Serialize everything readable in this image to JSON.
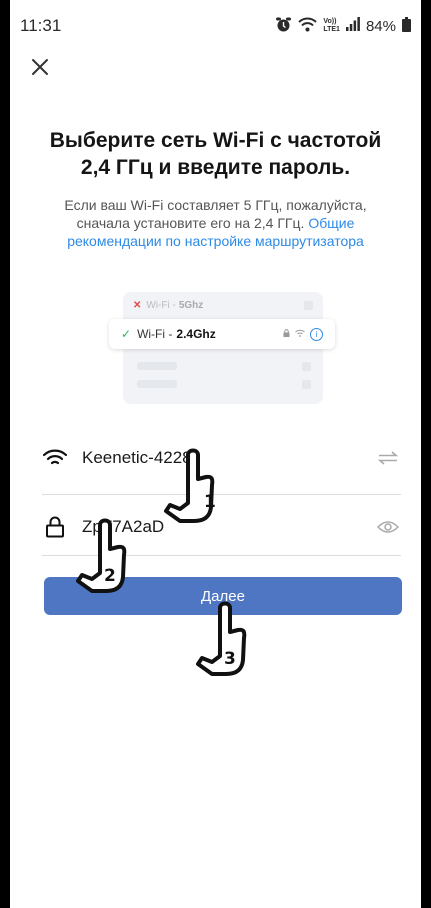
{
  "status_bar": {
    "time": "11:31",
    "battery": "84%",
    "volte_top": "Vo))",
    "volte_bottom": "LTE1",
    "icons": [
      "alarm-icon",
      "wifi-icon",
      "volte-icon",
      "signal-icon",
      "battery-icon"
    ]
  },
  "header": {
    "close_icon": "close-icon"
  },
  "title": "Выберите сеть Wi-Fi с частотой 2,4 ГГц и введите пароль.",
  "subtitle": {
    "text": "Если ваш Wi-Fi составляет 5 ГГц, пожалуйста, сначала установите его на 2,4 ГГц. ",
    "link": "Общие рекомендации по настройке маршрутизатора"
  },
  "illustration": {
    "row_5ghz_prefix": "Wi-Fi - ",
    "row_5ghz_band": "5Ghz",
    "row_24ghz_prefix": "Wi-Fi - ",
    "row_24ghz_band": "2.4Ghz"
  },
  "form": {
    "ssid_value": "Keenetic-4228",
    "password_value": "ZpF7A2aD"
  },
  "next_button": "Далее",
  "callouts": [
    {
      "number": "1"
    },
    {
      "number": "2"
    },
    {
      "number": "3"
    }
  ],
  "colors": {
    "accent": "#4f76c2",
    "link": "#2d8ae6",
    "check": "#2fb35a",
    "cross": "#e24a4a"
  }
}
